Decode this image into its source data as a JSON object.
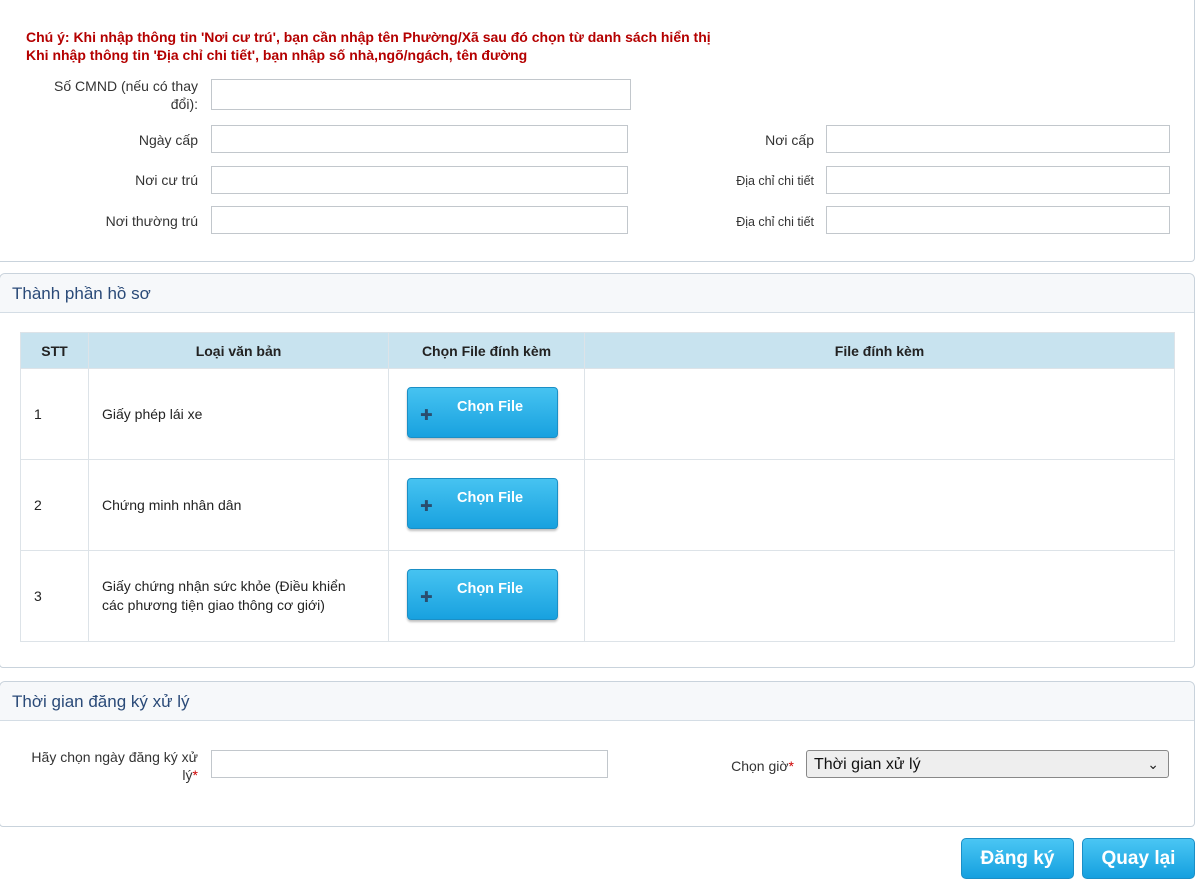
{
  "notice": {
    "line1": "Chú ý: Khi nhập thông tin 'Nơi cư trú', bạn cần nhập tên Phường/Xã sau đó chọn từ danh sách hiển thị",
    "line2": "Khi nhập thông tin 'Địa chỉ chi tiết', bạn nhập số nhà,ngõ/ngách, tên đường"
  },
  "form": {
    "cmnd_label_1": "Số CMND (nếu có thay",
    "cmnd_label_2": "đổi):",
    "cmnd_value": "",
    "ngay_cap_label": "Ngày cấp",
    "ngay_cap_value": "",
    "noi_cap_label": "Nơi cấp",
    "noi_cap_value": "",
    "noi_cu_tru_label": "Nơi cư trú",
    "noi_cu_tru_value": "",
    "dia_chi_1_label": "Địa chỉ chi tiết",
    "dia_chi_1_value": "",
    "noi_thuong_tru_label": "Nơi thường trú",
    "noi_thuong_tru_value": "",
    "dia_chi_2_label": "Địa chỉ chi tiết",
    "dia_chi_2_value": ""
  },
  "files_section": {
    "title": "Thành phần hồ sơ",
    "headers": [
      "STT",
      "Loại văn bản",
      "Chọn File đính kèm",
      "File đính kèm"
    ],
    "button_label": "Chọn File",
    "button_icon": "plus-icon",
    "rows": [
      {
        "stt": "1",
        "loai_1": "Giấy phép lái xe",
        "loai_2": "",
        "file": ""
      },
      {
        "stt": "2",
        "loai_1": "Chứng minh nhân dân",
        "loai_2": "",
        "file": ""
      },
      {
        "stt": "3",
        "loai_1": "Giấy chứng nhận sức khỏe (Điều khiển",
        "loai_2": "các phương tiện giao thông cơ giới)",
        "file": ""
      }
    ]
  },
  "time_section": {
    "title": "Thời gian đăng ký xử lý",
    "date_label_1": "Hãy chọn ngày đăng ký xử",
    "date_label_2": "lý",
    "date_value": "",
    "time_label": "Chọn giờ",
    "required_mark": "*",
    "time_selected": "Thời gian xử lý"
  },
  "actions": {
    "submit_label": "Đăng ký",
    "back_label": "Quay lại"
  },
  "colors": {
    "notice": "#b40000",
    "header_bg": "#c8e3ef",
    "button": "#18a1df",
    "section_title": "#2a4a78"
  }
}
